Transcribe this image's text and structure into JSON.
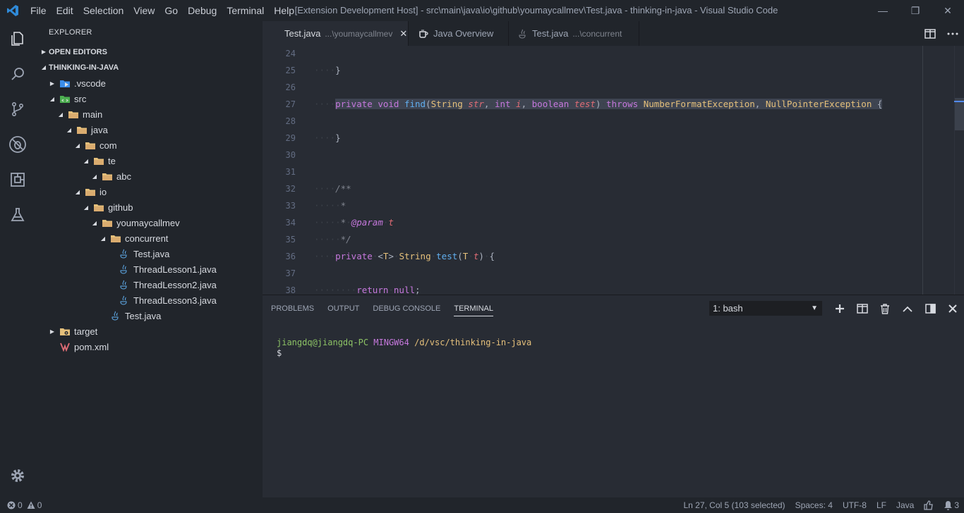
{
  "window": {
    "title": "[Extension Development Host] - src\\main\\java\\io\\github\\youmaycallmev\\Test.java - thinking-in-java - Visual Studio Code",
    "controls": {
      "minimize": "—",
      "maximize": "❐",
      "close": "✕"
    }
  },
  "menu": [
    "File",
    "Edit",
    "Selection",
    "View",
    "Go",
    "Debug",
    "Terminal",
    "Help"
  ],
  "activity": [
    "explorer-icon",
    "search-icon",
    "source-control-icon",
    "debug-icon",
    "extensions-icon",
    "test-flask-icon",
    "gear-icon"
  ],
  "sidebar": {
    "title": "EXPLORER",
    "open_editors": "OPEN EDITORS",
    "project": "THINKING-IN-JAVA",
    "tree": [
      {
        "label": ".vscode",
        "depth": 0,
        "kind": "vscode",
        "twisty": "closed"
      },
      {
        "label": "src",
        "depth": 0,
        "kind": "src",
        "twisty": "open"
      },
      {
        "label": "main",
        "depth": 1,
        "kind": "folder",
        "twisty": "open"
      },
      {
        "label": "java",
        "depth": 2,
        "kind": "folder",
        "twisty": "open"
      },
      {
        "label": "com",
        "depth": 3,
        "kind": "folder",
        "twisty": "open"
      },
      {
        "label": "te",
        "depth": 4,
        "kind": "folder",
        "twisty": "open"
      },
      {
        "label": "abc",
        "depth": 5,
        "kind": "folder",
        "twisty": "open"
      },
      {
        "label": "io",
        "depth": 3,
        "kind": "folder",
        "twisty": "open"
      },
      {
        "label": "github",
        "depth": 4,
        "kind": "folder",
        "twisty": "open"
      },
      {
        "label": "youmaycallmev",
        "depth": 5,
        "kind": "folder",
        "twisty": "open"
      },
      {
        "label": "concurrent",
        "depth": 6,
        "kind": "folder",
        "twisty": "open"
      },
      {
        "label": "Test.java",
        "depth": 7,
        "kind": "java",
        "twisty": "none"
      },
      {
        "label": "ThreadLesson1.java",
        "depth": 7,
        "kind": "java",
        "twisty": "none"
      },
      {
        "label": "ThreadLesson2.java",
        "depth": 7,
        "kind": "java",
        "twisty": "none"
      },
      {
        "label": "ThreadLesson3.java",
        "depth": 7,
        "kind": "java",
        "twisty": "none"
      },
      {
        "label": "Test.java",
        "depth": 6,
        "kind": "java",
        "twisty": "none"
      },
      {
        "label": "target",
        "depth": 0,
        "kind": "target",
        "twisty": "closed"
      },
      {
        "label": "pom.xml",
        "depth": 0,
        "kind": "maven",
        "twisty": "none"
      }
    ]
  },
  "tabs": [
    {
      "label": "Test.java",
      "desc": "...\\youmaycallmev",
      "active": true,
      "icon": "java-file-icon",
      "close": "✕"
    },
    {
      "label": "Java Overview",
      "desc": "",
      "active": false,
      "icon": "java-overview-icon"
    },
    {
      "label": "Test.java",
      "desc": "...\\concurrent",
      "active": false,
      "icon": "java-file-icon"
    }
  ],
  "editor": {
    "lines": [
      {
        "n": "24",
        "html": ""
      },
      {
        "n": "25",
        "html": "<span class='ws'>····</span>}"
      },
      {
        "n": "26",
        "html": ""
      },
      {
        "n": "27",
        "html": "<span class='ws'>····</span><span class='sel'><span class='kw'>private</span><span class='ws'>·</span><span class='kw'>void</span><span class='ws'>·</span><span class='fn'>find</span>(<span class='ty'>String</span><span class='ws'>·</span><span class='pr'>str</span>,<span class='ws'>·</span><span class='kw'>int</span><span class='ws'>·</span><span class='pr'>i</span>,<span class='ws'>·</span><span class='kw'>boolean</span><span class='ws'>·</span><span class='pr'>test</span>)<span class='ws'>·</span><span class='kw'>throws</span><span class='ws'>·</span><span class='ty'>NumberFormatException</span>,<span class='ws'>·</span><span class='ty'>NullPointerException</span><span class='ws'>·</span>{</span>"
      },
      {
        "n": "28",
        "html": ""
      },
      {
        "n": "29",
        "html": "<span class='ws'>····</span>}"
      },
      {
        "n": "30",
        "html": ""
      },
      {
        "n": "31",
        "html": ""
      },
      {
        "n": "32",
        "html": "<span class='ws'>····</span><span class='cm'>/**</span>"
      },
      {
        "n": "33",
        "html": "<span class='ws'>·····</span><span class='cm'>*</span>"
      },
      {
        "n": "34",
        "html": "<span class='ws'>·····</span><span class='cm'>*</span><span class='ws'>·</span><span class='tag'>@param</span><span class='ws'>·</span><span class='pr'>t</span>"
      },
      {
        "n": "35",
        "html": "<span class='ws'>·····</span><span class='cm'>*/</span>"
      },
      {
        "n": "36",
        "html": "<span class='ws'>····</span><span class='kw'>private</span><span class='ws'>·</span>&lt;<span class='ty'>T</span>&gt;<span class='ws'>·</span><span class='ty'>String</span><span class='ws'>·</span><span class='fn'>test</span>(<span class='ty'>T</span><span class='ws'>·</span><span class='pr'>t</span>)<span class='ws'>·</span>{"
      },
      {
        "n": "37",
        "html": ""
      },
      {
        "n": "38",
        "html": "<span class='ws'>········</span><span class='kw'>return</span><span class='ws'>·</span><span class='kw'>null</span>;"
      }
    ]
  },
  "panel": {
    "tabs": [
      "PROBLEMS",
      "OUTPUT",
      "DEBUG CONSOLE",
      "TERMINAL"
    ],
    "active_tab": "TERMINAL",
    "terminal_select": "1: bash",
    "terminal": {
      "user": "jiangdq@jiangdq-PC",
      "host": "MINGW64",
      "path": "/d/vsc/thinking-in-java",
      "prompt": "$"
    }
  },
  "status": {
    "errors": "0",
    "warnings": "0",
    "position": "Ln 27, Col 5 (103 selected)",
    "spaces": "Spaces: 4",
    "encoding": "UTF-8",
    "eol": "LF",
    "language": "Java",
    "notifications": "3"
  },
  "colors": {
    "accent": "#528bff",
    "folder": "#e5c07b",
    "java": "#61afef"
  }
}
